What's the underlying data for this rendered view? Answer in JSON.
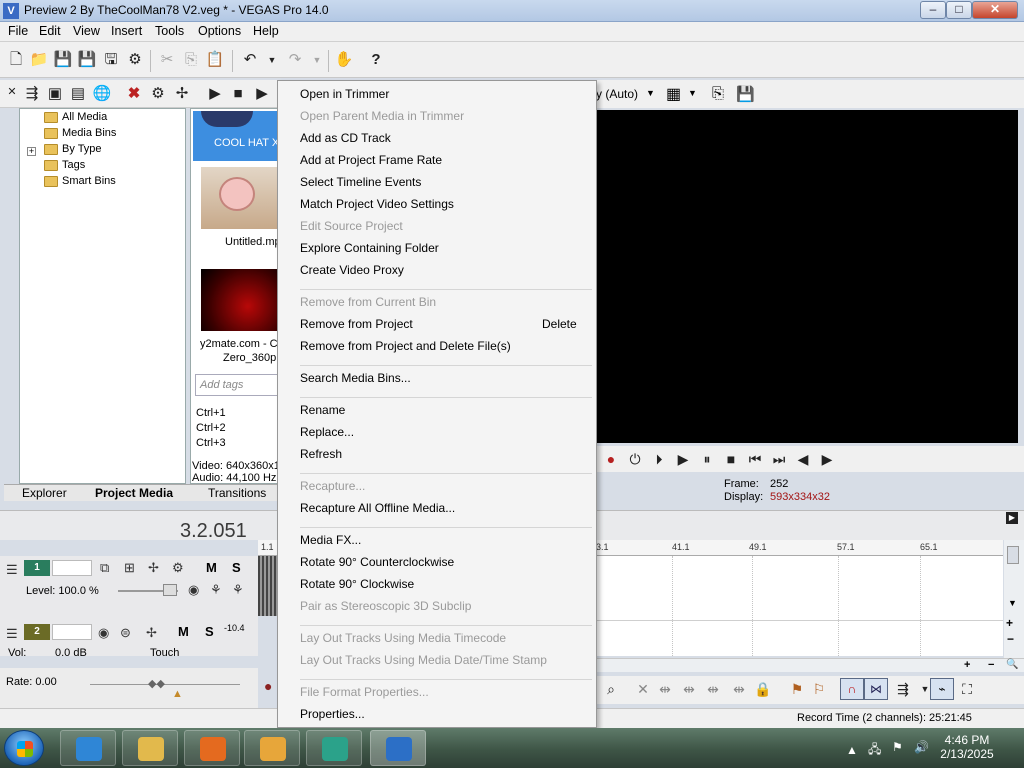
{
  "colors": {
    "accent": "#3a6bc4",
    "selected_thumb": "#3d8ee0",
    "display_value": "#a31515",
    "track1": "#2a7d5e",
    "track2": "#6b6b26"
  },
  "window": {
    "title": "Preview 2 By TheCoolMan78 V2.veg * - VEGAS Pro 14.0",
    "app_icon": "V",
    "minimize": "–",
    "maximize": "□",
    "close": "✕"
  },
  "menubar": [
    "File",
    "Edit",
    "View",
    "Insert",
    "Tools",
    "Options",
    "Help"
  ],
  "explorer": {
    "items": [
      {
        "label": "All Media",
        "indent": 0
      },
      {
        "label": "Media Bins",
        "indent": 0
      },
      {
        "label": "By Type",
        "indent": 0,
        "expander": "+"
      },
      {
        "label": "Tags",
        "indent": 0
      },
      {
        "label": "Smart Bins",
        "indent": 0
      }
    ]
  },
  "media": {
    "items": [
      {
        "label": "COOL HAT X.",
        "selected": true
      },
      {
        "label": "Untitled.mp"
      },
      {
        "label": "y2mate.com - Co"
      },
      {
        "label": "Zero_360p.n"
      }
    ],
    "tags_placeholder": "Add tags",
    "shortcuts": [
      "Ctrl+1",
      "Ctrl+2",
      "Ctrl+3"
    ],
    "video_info": "Video: 640x360x1",
    "audio_info": "Audio: 44,100 Hz,"
  },
  "tabs": [
    "Explorer",
    "Project Media",
    "Transitions"
  ],
  "preview": {
    "quality": "y (Auto)",
    "frame_label": "Frame:",
    "frame_value": "252",
    "display_label": "Display:",
    "display_value": "593x334x32"
  },
  "timeline": {
    "time": "3.2.051",
    "ruler": [
      "1.1",
      "3.1",
      "41.1",
      "49.1",
      "57.1",
      "65.1"
    ],
    "track1": {
      "number": "1",
      "level": "Level: 100.0 %",
      "mute": "M",
      "solo": "S"
    },
    "track2": {
      "number": "2",
      "vol": "Vol:",
      "vol_value": "0.0 dB",
      "touch": "Touch",
      "mute": "M",
      "solo": "S",
      "meter": "-10.4"
    },
    "rate": "Rate: 0.00"
  },
  "status": {
    "record_time": "Record Time (2 channels): 25:21:45"
  },
  "context_menu": {
    "groups": [
      [
        {
          "label": "Open in Trimmer"
        },
        {
          "label": "Open Parent Media in Trimmer",
          "disabled": true
        },
        {
          "label": "Add as CD Track"
        },
        {
          "label": "Add at Project Frame Rate"
        },
        {
          "label": "Select Timeline Events"
        },
        {
          "label": "Match Project Video Settings"
        },
        {
          "label": "Edit Source Project",
          "disabled": true
        },
        {
          "label": "Explore Containing Folder"
        },
        {
          "label": "Create Video Proxy"
        }
      ],
      [
        {
          "label": "Remove from Current Bin",
          "disabled": true
        },
        {
          "label": "Remove from Project",
          "shortcut": "Delete"
        },
        {
          "label": "Remove from Project and Delete File(s)"
        }
      ],
      [
        {
          "label": "Search Media Bins..."
        }
      ],
      [
        {
          "label": "Rename"
        },
        {
          "label": "Replace..."
        },
        {
          "label": "Refresh"
        }
      ],
      [
        {
          "label": "Recapture...",
          "disabled": true
        },
        {
          "label": "Recapture All Offline Media..."
        }
      ],
      [
        {
          "label": "Media FX..."
        },
        {
          "label": "Rotate 90° Counterclockwise"
        },
        {
          "label": "Rotate 90° Clockwise"
        },
        {
          "label": "Pair as Stereoscopic 3D Subclip",
          "disabled": true
        }
      ],
      [
        {
          "label": "Lay Out Tracks Using Media Timecode",
          "disabled": true
        },
        {
          "label": "Lay Out Tracks Using Media Date/Time Stamp",
          "disabled": true
        }
      ],
      [
        {
          "label": "File Format Properties...",
          "disabled": true
        },
        {
          "label": "Properties..."
        }
      ]
    ]
  },
  "taskbar": {
    "apps": [
      {
        "name": "internet-explorer",
        "color": "#2f86d6"
      },
      {
        "name": "file-explorer",
        "color": "#e2b94c"
      },
      {
        "name": "firefox",
        "color": "#e46a1f"
      },
      {
        "name": "media-player",
        "color": "#e7a63a"
      },
      {
        "name": "app-teal",
        "color": "#2ba28a"
      },
      {
        "name": "vegas-pro",
        "color": "#2c6fc6"
      }
    ],
    "time": "4:46 PM",
    "date": "2/13/2025"
  }
}
